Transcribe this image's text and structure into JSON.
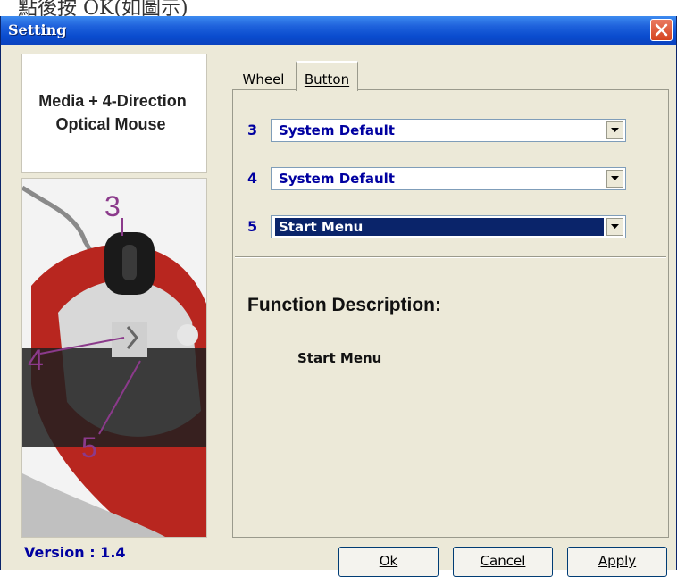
{
  "caption": {
    "text": "點後按 OK(如圖示)"
  },
  "window": {
    "title": "Setting"
  },
  "product": {
    "line1": "Media + 4-Direction",
    "line2": "Optical Mouse"
  },
  "mouse_image": {
    "callouts": [
      "3",
      "4",
      "5"
    ]
  },
  "version": "Version : 1.4",
  "tabs": [
    {
      "label": "Wheel",
      "active": false
    },
    {
      "label": "Button",
      "active": true
    }
  ],
  "buttons_mapping": [
    {
      "number": "3",
      "value": "System Default",
      "selected": false
    },
    {
      "number": "4",
      "value": "System Default",
      "selected": false
    },
    {
      "number": "5",
      "value": "Start Menu",
      "selected": true
    }
  ],
  "function_description": {
    "title": "Function Description:",
    "value": "Start Menu"
  },
  "actions": {
    "ok": "Ok",
    "cancel": "Cancel",
    "apply": "Apply"
  },
  "colors": {
    "titlebar": "#0a4ccf",
    "label_blue": "#0000a0",
    "selection": "#0a246a",
    "dialog_bg": "#ece9d8"
  }
}
